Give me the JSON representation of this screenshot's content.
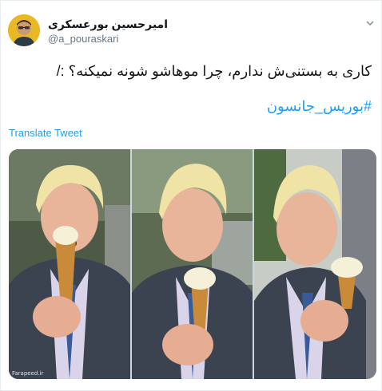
{
  "author": {
    "display_name": "امیرحسین بورعسکری",
    "handle": "@a_pouraskari"
  },
  "tweet": {
    "text": "کاری به بستنی‌ش ندارم، چرا موهاشو شونه نمیکنه؟ :/",
    "hashtag": "#بوریس_جانسون",
    "translate_label": "Translate Tweet"
  },
  "media": {
    "photo_count": 3,
    "watermark": "Farapeed.ir"
  },
  "icons": {
    "caret": "chevron-down-icon"
  },
  "colors": {
    "link": "#1da1f2",
    "text": "#14171a",
    "secondary": "#657786",
    "border": "#e6ecf0"
  }
}
